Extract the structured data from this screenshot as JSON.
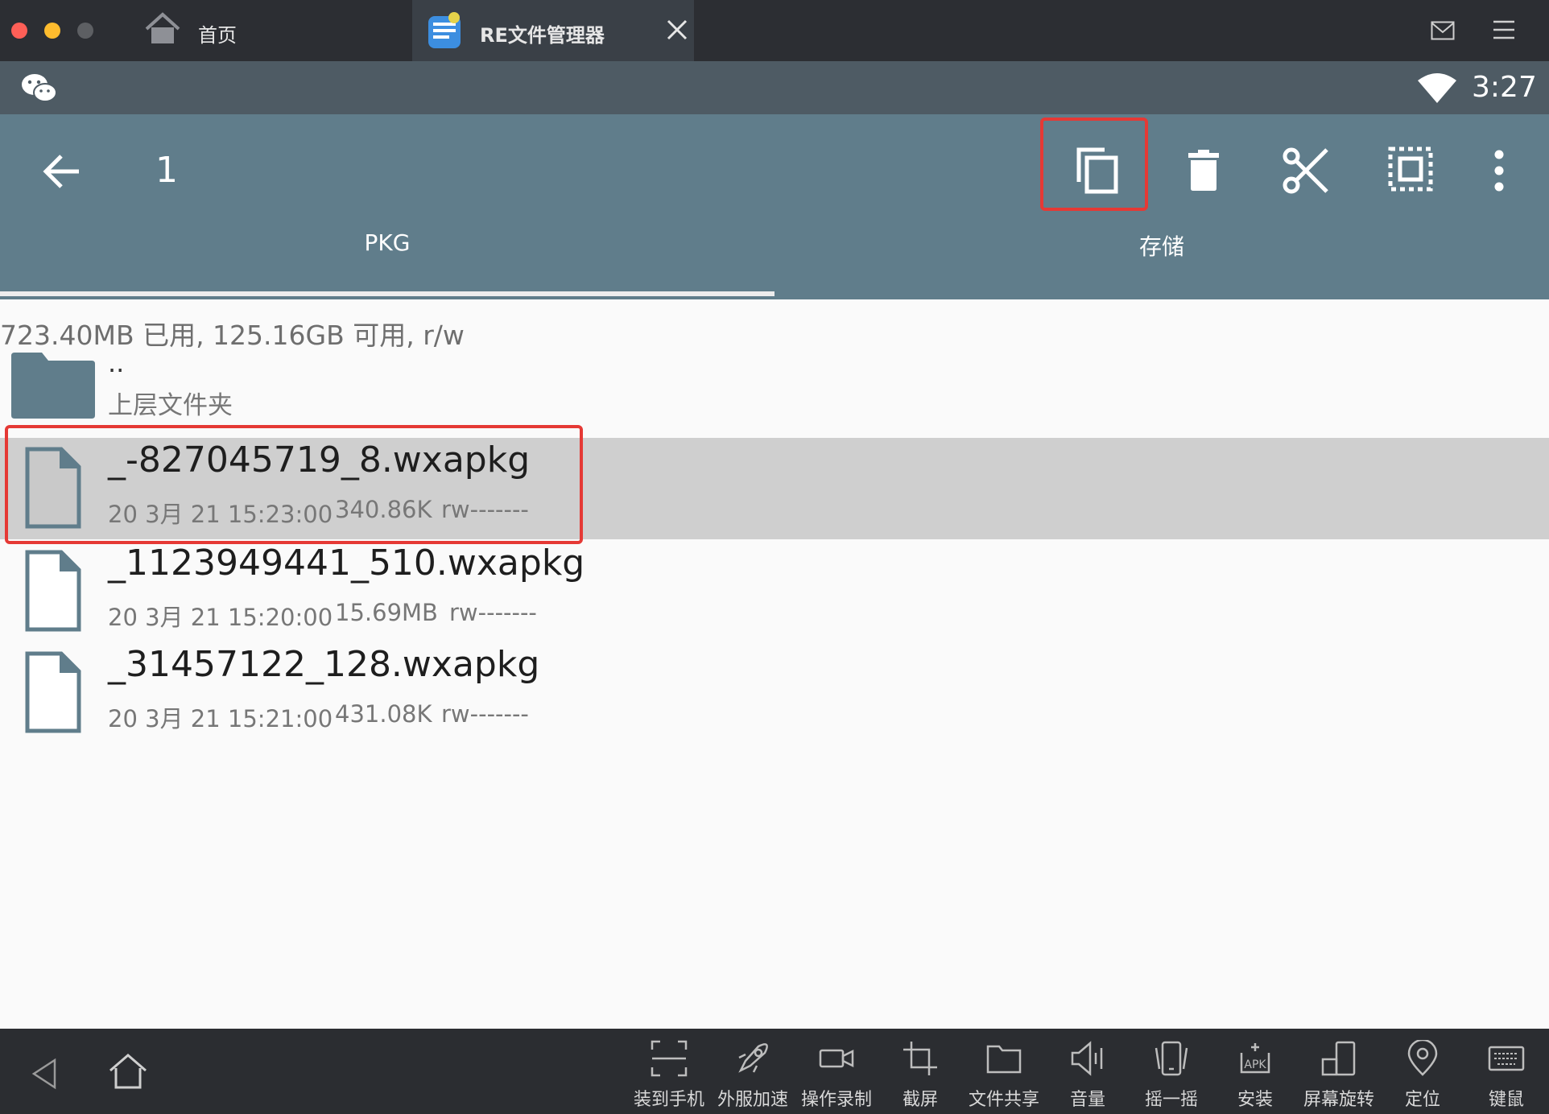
{
  "window": {
    "tabs": [
      {
        "label": "首页"
      },
      {
        "label": "RE文件管理器"
      }
    ]
  },
  "status_bar": {
    "time": "3:27"
  },
  "app_bar": {
    "selection_count": "1",
    "tabs": [
      {
        "label": "PKG",
        "active": true
      },
      {
        "label": "存储",
        "active": false
      }
    ]
  },
  "storage_info": "723.40MB 已用, 125.16GB 可用, r/w",
  "parent_folder": {
    "name": "..",
    "label": "上层文件夹"
  },
  "files": [
    {
      "name": "_-827045719_8.wxapkg",
      "date": "20 3月 21 15:23:00",
      "size": "340.86K",
      "perm": "rw-------",
      "selected": true
    },
    {
      "name": "_1123949441_510.wxapkg",
      "date": "20 3月 21 15:20:00",
      "size": "15.69MB",
      "perm": "rw-------",
      "selected": false
    },
    {
      "name": "_31457122_128.wxapkg",
      "date": "20 3月 21 15:21:00",
      "size": "431.08K",
      "perm": "rw-------",
      "selected": false
    }
  ],
  "bottom_tools": [
    {
      "label": "装到手机",
      "icon": "scan-frame-icon"
    },
    {
      "label": "外服加速",
      "icon": "rocket-icon"
    },
    {
      "label": "操作录制",
      "icon": "video-camera-icon"
    },
    {
      "label": "截屏",
      "icon": "crop-icon"
    },
    {
      "label": "文件共享",
      "icon": "folder-icon"
    },
    {
      "label": "音量",
      "icon": "speaker-icon"
    },
    {
      "label": "摇一摇",
      "icon": "shake-phone-icon"
    },
    {
      "label": "安装",
      "icon": "apk-install-icon"
    },
    {
      "label": "屏幕旋转",
      "icon": "rotate-screen-icon"
    },
    {
      "label": "定位",
      "icon": "location-pin-icon"
    },
    {
      "label": "键鼠",
      "icon": "keyboard-icon"
    }
  ],
  "colors": {
    "appbar": "#607d8b",
    "statusbar": "#4e5b64",
    "highlight_box": "#e53935",
    "selected_row": "#cfcfcf"
  }
}
